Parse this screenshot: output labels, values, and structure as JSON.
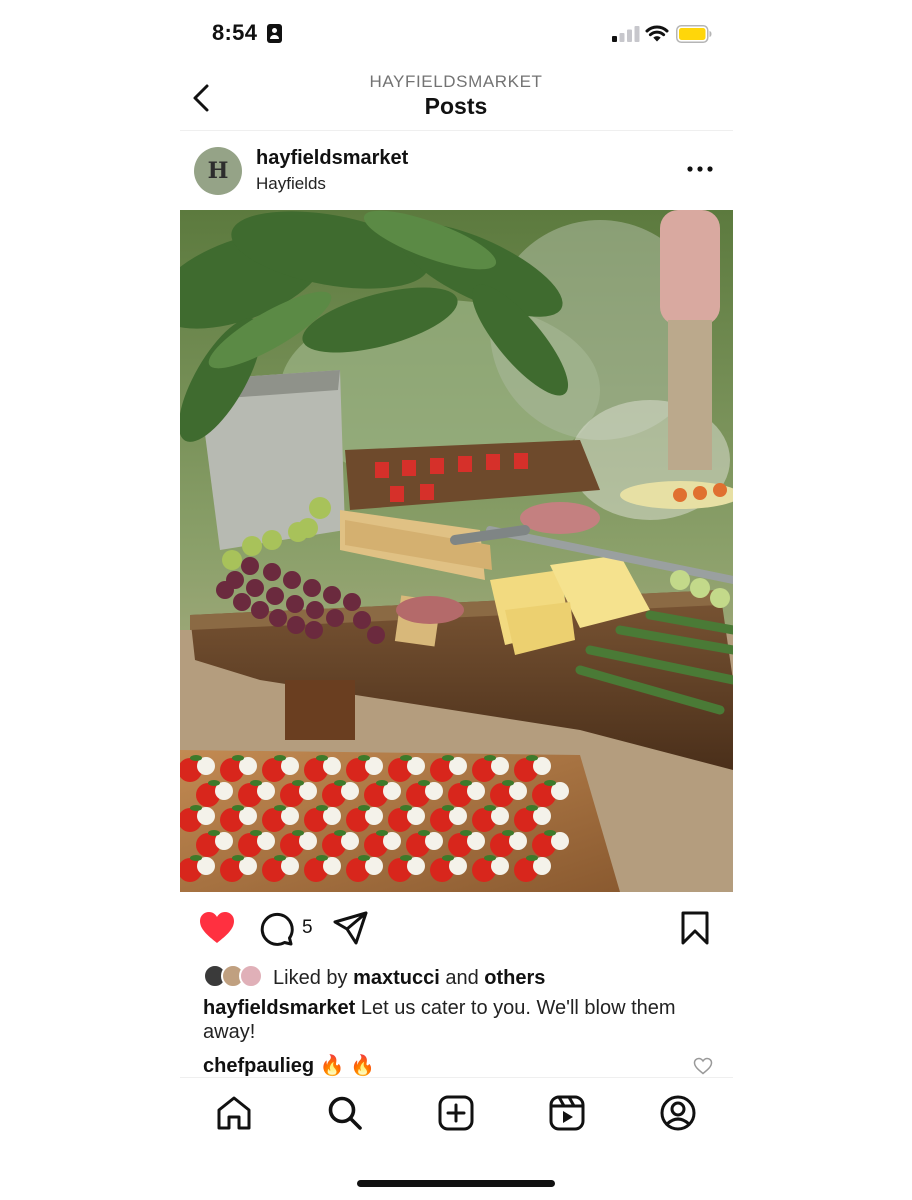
{
  "status_bar": {
    "time": "8:54",
    "icons": [
      "id-badge-icon",
      "cellular-signal-icon",
      "wifi-icon",
      "battery-icon"
    ],
    "battery_color": "#ffd60a"
  },
  "header": {
    "account": "HAYFIELDSMARKET",
    "title": "Posts",
    "back_icon": "chevron-left-icon"
  },
  "post": {
    "avatar_letter": "H",
    "username": "hayfieldsmarket",
    "location": "Hayfields",
    "more_icon": "more-horizontal-icon",
    "image_description_icon": "photo",
    "actions": {
      "liked": true,
      "like_color": "#ff3040",
      "comment_count": "5"
    },
    "likes": {
      "prefix": "Liked by",
      "user": "maxtucci",
      "conjunction": "and",
      "others": "others"
    },
    "caption": {
      "username": "hayfieldsmarket",
      "text": "Let us cater to you. We'll blow them away!"
    },
    "comment": {
      "username": "chefpaulieg",
      "text": "🔥 🔥"
    }
  },
  "bottom_nav": {
    "items": [
      "home-icon",
      "search-icon",
      "new-post-icon",
      "reels-icon",
      "profile-icon"
    ]
  }
}
